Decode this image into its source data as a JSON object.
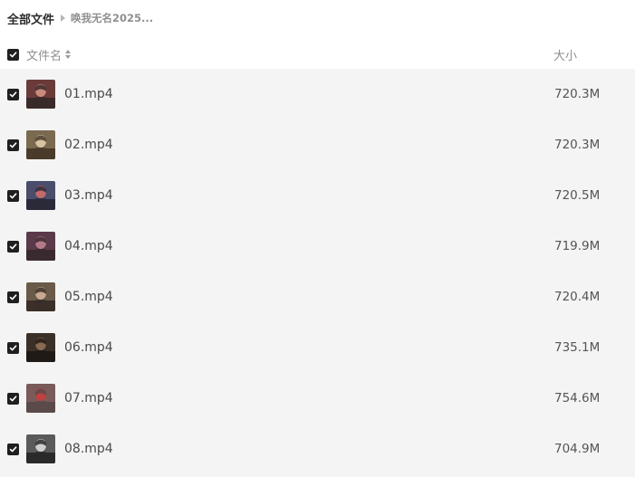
{
  "breadcrumb": {
    "root": "全部文件",
    "current": "唤我无名2025..."
  },
  "header": {
    "name_label": "文件名",
    "size_label": "大小",
    "select_all_checked": true,
    "sort_icon": "sort-icon"
  },
  "files": [
    {
      "name": "01.mp4",
      "size": "720.3M",
      "checked": true,
      "thumb_colors": [
        "#6b3b3a",
        "#c98a7e",
        "#3a2a2a"
      ]
    },
    {
      "name": "02.mp4",
      "size": "720.3M",
      "checked": true,
      "thumb_colors": [
        "#7a6a50",
        "#d8c3a0",
        "#4a3b2a"
      ]
    },
    {
      "name": "03.mp4",
      "size": "720.5M",
      "checked": true,
      "thumb_colors": [
        "#4a4e6b",
        "#c46a6a",
        "#2a2a3a"
      ]
    },
    {
      "name": "04.mp4",
      "size": "719.9M",
      "checked": true,
      "thumb_colors": [
        "#5a3a4a",
        "#b47a8a",
        "#3a2a30"
      ]
    },
    {
      "name": "05.mp4",
      "size": "720.4M",
      "checked": true,
      "thumb_colors": [
        "#6a5a4a",
        "#c8a890",
        "#3a3028"
      ]
    },
    {
      "name": "06.mp4",
      "size": "735.1M",
      "checked": true,
      "thumb_colors": [
        "#3a3028",
        "#8a6a50",
        "#201a16"
      ]
    },
    {
      "name": "07.mp4",
      "size": "754.6M",
      "checked": true,
      "thumb_colors": [
        "#7a5a5a",
        "#c04040",
        "#5a4a4a"
      ]
    },
    {
      "name": "08.mp4",
      "size": "704.9M",
      "checked": true,
      "thumb_colors": [
        "#5a5a5a",
        "#d0d0d0",
        "#2a2a2a"
      ]
    }
  ]
}
